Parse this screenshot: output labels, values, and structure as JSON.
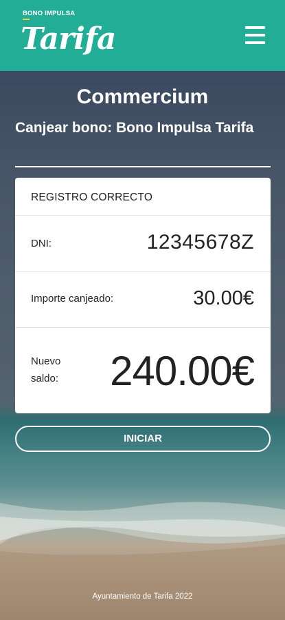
{
  "header": {
    "logo_top": "BONO IMPULSA",
    "logo_main": "Tarifa",
    "menu_icon": "hamburger-menu-icon"
  },
  "page": {
    "title": "Commercium",
    "subtitle": "Canjear bono: Bono Impulsa Tarifa"
  },
  "card": {
    "status": "REGISTRO CORRECTO",
    "dni_label": "DNI:",
    "dni_value": "12345678Z",
    "importe_label": "Importe canjeado:",
    "importe_value": "30.00€",
    "saldo_label": "Nuevo saldo:",
    "saldo_value": "240.00€"
  },
  "actions": {
    "iniciar_label": "INICIAR"
  },
  "footer": {
    "text": "Ayuntamiento de Tarifa 2022"
  },
  "colors": {
    "header_bg": "#22ad97",
    "accent_line": "#f2d03b"
  }
}
